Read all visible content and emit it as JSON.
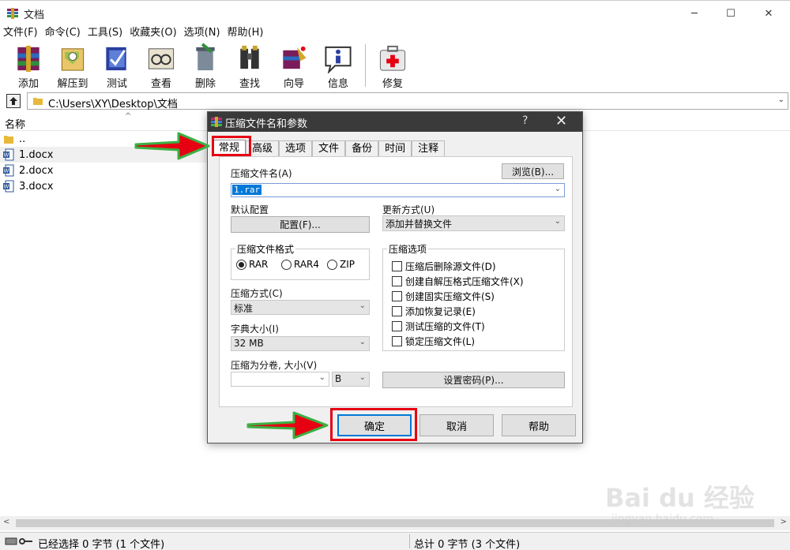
{
  "window": {
    "title": "文档",
    "min_symbol": "─",
    "max_symbol": "☐",
    "close_symbol": "✕"
  },
  "menu": [
    "文件(F)",
    "命令(C)",
    "工具(S)",
    "收藏夹(O)",
    "选项(N)",
    "帮助(H)"
  ],
  "toolbar": {
    "items": [
      {
        "label": "添加",
        "icon": "add-archive-icon"
      },
      {
        "label": "解压到",
        "icon": "extract-to-icon"
      },
      {
        "label": "测试",
        "icon": "test-icon"
      },
      {
        "label": "查看",
        "icon": "view-icon"
      },
      {
        "label": "删除",
        "icon": "delete-icon"
      },
      {
        "label": "查找",
        "icon": "find-icon"
      },
      {
        "label": "向导",
        "icon": "wizard-icon"
      },
      {
        "label": "信息",
        "icon": "info-icon"
      }
    ],
    "extra": {
      "label": "修复",
      "icon": "repair-icon"
    }
  },
  "address": {
    "path": "C:\\Users\\XY\\Desktop\\文档",
    "dropdown": "⌄"
  },
  "list": {
    "header_name": "名称",
    "sort_indicator": "^",
    "rows": [
      {
        "name": ".."
      },
      {
        "name": "1.docx"
      },
      {
        "name": "2.docx"
      },
      {
        "name": "3.docx"
      }
    ]
  },
  "scroll": {
    "left": "<",
    "right": ">"
  },
  "status": {
    "left": "已经选择 0 字节 (1 个文件)",
    "right": "总计 0 字节 (3 个文件)"
  },
  "dialog": {
    "title": "压缩文件名和参数",
    "help": "?",
    "close": "✕",
    "tabs": [
      "常规",
      "高级",
      "选项",
      "文件",
      "备份",
      "时间",
      "注释"
    ],
    "archive_name_label": "压缩文件名(A)",
    "browse_button": "浏览(B)...",
    "archive_name_value": "1.rar",
    "default_profile_label": "默认配置",
    "profile_button": "配置(F)...",
    "update_mode_label": "更新方式(U)",
    "update_mode_value": "添加并替换文件",
    "format_group": "压缩文件格式",
    "formats": [
      "RAR",
      "RAR4",
      "ZIP"
    ],
    "selected_format": "RAR",
    "method_label": "压缩方式(C)",
    "method_value": "标准",
    "dict_label": "字典大小(I)",
    "dict_value": "32 MB",
    "split_label": "压缩为分卷, 大小(V)",
    "split_value": "",
    "split_unit": "B",
    "options_group": "压缩选项",
    "options": [
      "压缩后删除源文件(D)",
      "创建自解压格式压缩文件(X)",
      "创建固实压缩文件(S)",
      "添加恢复记录(E)",
      "测试压缩的文件(T)",
      "锁定压缩文件(L)"
    ],
    "password_button": "设置密码(P)...",
    "ok_button": "确定",
    "cancel_button": "取消",
    "help_button": "帮助",
    "combo_arrow": "⌄"
  },
  "watermark": {
    "brand": "Bai du 经验",
    "url": "jingyan.baidu.com"
  },
  "colors": {
    "annotation_red": "#e60012",
    "arrow_green": "#3cb043",
    "selection_blue": "#0078d7",
    "dialog_title": "#3a3a3a"
  }
}
